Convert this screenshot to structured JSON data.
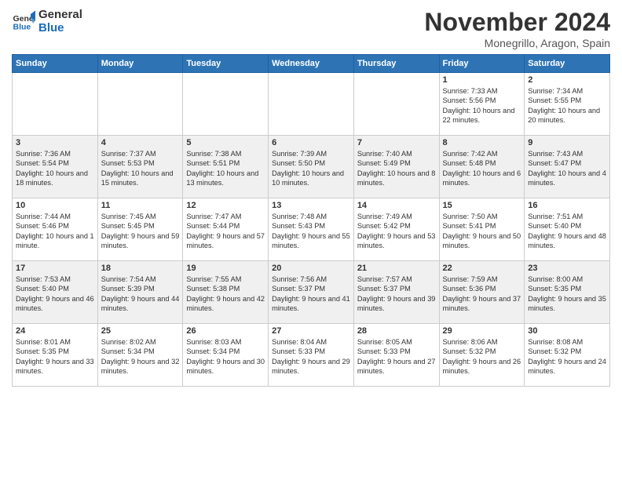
{
  "header": {
    "logo_line1": "General",
    "logo_line2": "Blue",
    "month_title": "November 2024",
    "location": "Monegrillo, Aragon, Spain"
  },
  "weekdays": [
    "Sunday",
    "Monday",
    "Tuesday",
    "Wednesday",
    "Thursday",
    "Friday",
    "Saturday"
  ],
  "weeks": [
    [
      {
        "day": "",
        "info": ""
      },
      {
        "day": "",
        "info": ""
      },
      {
        "day": "",
        "info": ""
      },
      {
        "day": "",
        "info": ""
      },
      {
        "day": "",
        "info": ""
      },
      {
        "day": "1",
        "info": "Sunrise: 7:33 AM\nSunset: 5:56 PM\nDaylight: 10 hours and 22 minutes."
      },
      {
        "day": "2",
        "info": "Sunrise: 7:34 AM\nSunset: 5:55 PM\nDaylight: 10 hours and 20 minutes."
      }
    ],
    [
      {
        "day": "3",
        "info": "Sunrise: 7:36 AM\nSunset: 5:54 PM\nDaylight: 10 hours and 18 minutes."
      },
      {
        "day": "4",
        "info": "Sunrise: 7:37 AM\nSunset: 5:53 PM\nDaylight: 10 hours and 15 minutes."
      },
      {
        "day": "5",
        "info": "Sunrise: 7:38 AM\nSunset: 5:51 PM\nDaylight: 10 hours and 13 minutes."
      },
      {
        "day": "6",
        "info": "Sunrise: 7:39 AM\nSunset: 5:50 PM\nDaylight: 10 hours and 10 minutes."
      },
      {
        "day": "7",
        "info": "Sunrise: 7:40 AM\nSunset: 5:49 PM\nDaylight: 10 hours and 8 minutes."
      },
      {
        "day": "8",
        "info": "Sunrise: 7:42 AM\nSunset: 5:48 PM\nDaylight: 10 hours and 6 minutes."
      },
      {
        "day": "9",
        "info": "Sunrise: 7:43 AM\nSunset: 5:47 PM\nDaylight: 10 hours and 4 minutes."
      }
    ],
    [
      {
        "day": "10",
        "info": "Sunrise: 7:44 AM\nSunset: 5:46 PM\nDaylight: 10 hours and 1 minute."
      },
      {
        "day": "11",
        "info": "Sunrise: 7:45 AM\nSunset: 5:45 PM\nDaylight: 9 hours and 59 minutes."
      },
      {
        "day": "12",
        "info": "Sunrise: 7:47 AM\nSunset: 5:44 PM\nDaylight: 9 hours and 57 minutes."
      },
      {
        "day": "13",
        "info": "Sunrise: 7:48 AM\nSunset: 5:43 PM\nDaylight: 9 hours and 55 minutes."
      },
      {
        "day": "14",
        "info": "Sunrise: 7:49 AM\nSunset: 5:42 PM\nDaylight: 9 hours and 53 minutes."
      },
      {
        "day": "15",
        "info": "Sunrise: 7:50 AM\nSunset: 5:41 PM\nDaylight: 9 hours and 50 minutes."
      },
      {
        "day": "16",
        "info": "Sunrise: 7:51 AM\nSunset: 5:40 PM\nDaylight: 9 hours and 48 minutes."
      }
    ],
    [
      {
        "day": "17",
        "info": "Sunrise: 7:53 AM\nSunset: 5:40 PM\nDaylight: 9 hours and 46 minutes."
      },
      {
        "day": "18",
        "info": "Sunrise: 7:54 AM\nSunset: 5:39 PM\nDaylight: 9 hours and 44 minutes."
      },
      {
        "day": "19",
        "info": "Sunrise: 7:55 AM\nSunset: 5:38 PM\nDaylight: 9 hours and 42 minutes."
      },
      {
        "day": "20",
        "info": "Sunrise: 7:56 AM\nSunset: 5:37 PM\nDaylight: 9 hours and 41 minutes."
      },
      {
        "day": "21",
        "info": "Sunrise: 7:57 AM\nSunset: 5:37 PM\nDaylight: 9 hours and 39 minutes."
      },
      {
        "day": "22",
        "info": "Sunrise: 7:59 AM\nSunset: 5:36 PM\nDaylight: 9 hours and 37 minutes."
      },
      {
        "day": "23",
        "info": "Sunrise: 8:00 AM\nSunset: 5:35 PM\nDaylight: 9 hours and 35 minutes."
      }
    ],
    [
      {
        "day": "24",
        "info": "Sunrise: 8:01 AM\nSunset: 5:35 PM\nDaylight: 9 hours and 33 minutes."
      },
      {
        "day": "25",
        "info": "Sunrise: 8:02 AM\nSunset: 5:34 PM\nDaylight: 9 hours and 32 minutes."
      },
      {
        "day": "26",
        "info": "Sunrise: 8:03 AM\nSunset: 5:34 PM\nDaylight: 9 hours and 30 minutes."
      },
      {
        "day": "27",
        "info": "Sunrise: 8:04 AM\nSunset: 5:33 PM\nDaylight: 9 hours and 29 minutes."
      },
      {
        "day": "28",
        "info": "Sunrise: 8:05 AM\nSunset: 5:33 PM\nDaylight: 9 hours and 27 minutes."
      },
      {
        "day": "29",
        "info": "Sunrise: 8:06 AM\nSunset: 5:32 PM\nDaylight: 9 hours and 26 minutes."
      },
      {
        "day": "30",
        "info": "Sunrise: 8:08 AM\nSunset: 5:32 PM\nDaylight: 9 hours and 24 minutes."
      }
    ]
  ]
}
